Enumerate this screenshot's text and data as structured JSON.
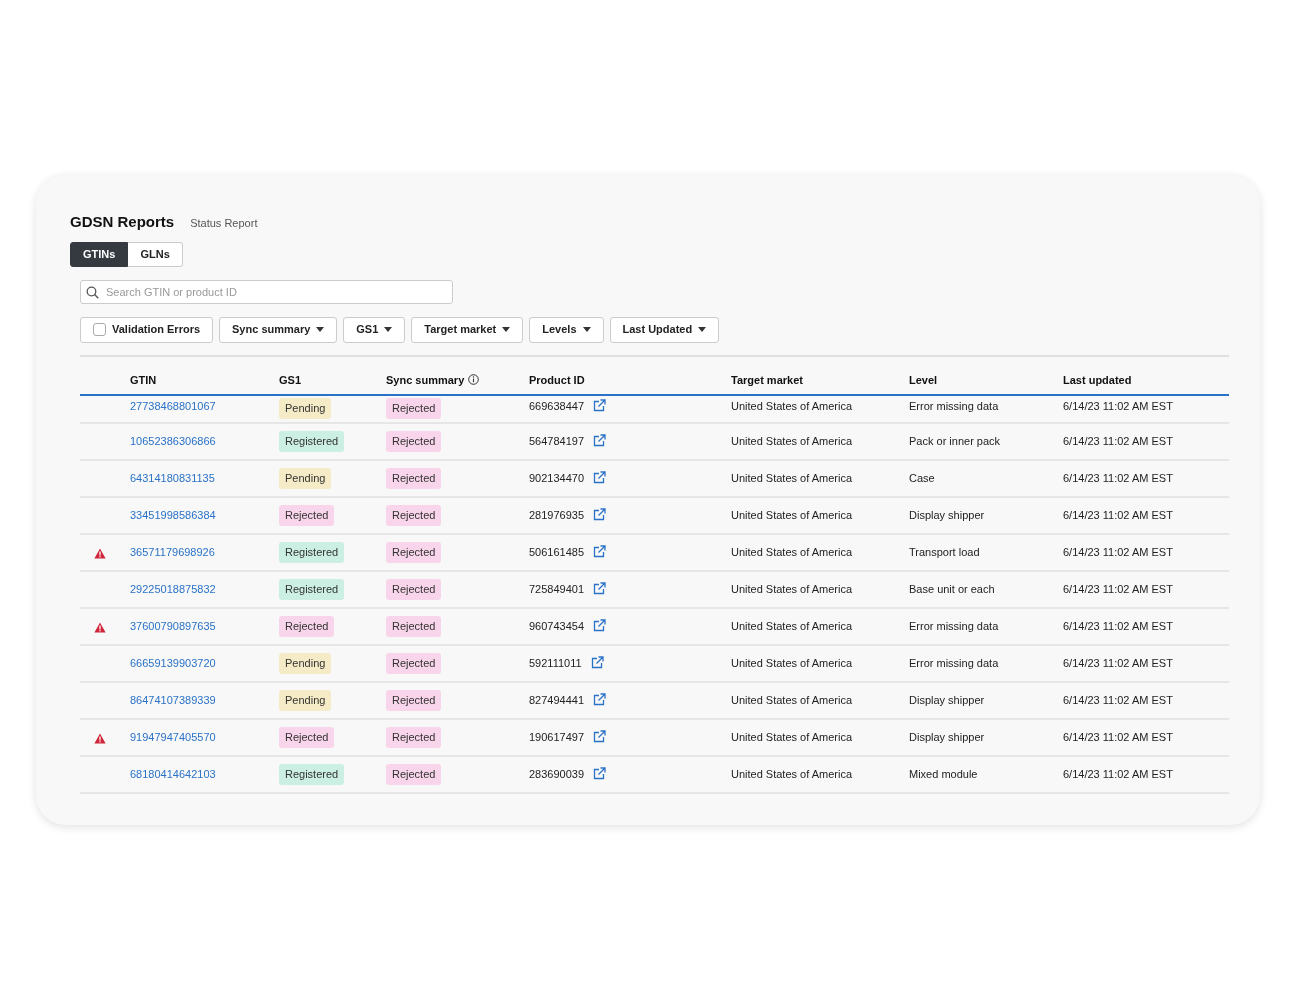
{
  "header": {
    "title": "GDSN Reports",
    "subtitle": "Status Report"
  },
  "tabs": [
    {
      "label": "GTINs",
      "selected": true
    },
    {
      "label": "GLNs",
      "selected": false
    }
  ],
  "search": {
    "placeholder": "Search GTIN or product ID"
  },
  "filters": [
    {
      "kind": "checkbox",
      "label": "Validation Errors",
      "checked": false
    },
    {
      "kind": "dropdown",
      "label": "Sync summary"
    },
    {
      "kind": "dropdown",
      "label": "GS1"
    },
    {
      "kind": "dropdown",
      "label": "Target market"
    },
    {
      "kind": "dropdown",
      "label": "Levels"
    },
    {
      "kind": "dropdown",
      "label": "Last Updated"
    }
  ],
  "table": {
    "columns": [
      {
        "label": "GTIN"
      },
      {
        "label": "GS1"
      },
      {
        "label": "Sync summary",
        "info": true
      },
      {
        "label": "Product ID"
      },
      {
        "label": "Target market"
      },
      {
        "label": "Level"
      },
      {
        "label": "Last updated"
      }
    ],
    "rows": [
      {
        "warning": false,
        "gtin": "27738468801067",
        "gs1": {
          "label": "Pending",
          "kind": "pending"
        },
        "sync": {
          "label": "Rejected",
          "kind": "rejected"
        },
        "product_id": "669638447",
        "target_market": "United States of America",
        "level": "Error missing data",
        "last_updated": "6/14/23 11:02 AM EST"
      },
      {
        "warning": false,
        "gtin": "10652386306866",
        "gs1": {
          "label": "Registered",
          "kind": "registered"
        },
        "sync": {
          "label": "Rejected",
          "kind": "rejected"
        },
        "product_id": "564784197",
        "target_market": "United States of America",
        "level": "Pack or inner pack",
        "last_updated": "6/14/23 11:02 AM EST"
      },
      {
        "warning": false,
        "gtin": "64314180831135",
        "gs1": {
          "label": "Pending",
          "kind": "pending"
        },
        "sync": {
          "label": "Rejected",
          "kind": "rejected"
        },
        "product_id": "902134470",
        "target_market": "United States of America",
        "level": "Case",
        "last_updated": "6/14/23 11:02 AM EST"
      },
      {
        "warning": false,
        "gtin": "33451998586384",
        "gs1": {
          "label": "Rejected",
          "kind": "rejected"
        },
        "sync": {
          "label": "Rejected",
          "kind": "rejected"
        },
        "product_id": "281976935",
        "target_market": "United States of America",
        "level": "Display shipper",
        "last_updated": "6/14/23 11:02 AM EST"
      },
      {
        "warning": true,
        "gtin": "36571179698926",
        "gs1": {
          "label": "Registered",
          "kind": "registered"
        },
        "sync": {
          "label": "Rejected",
          "kind": "rejected"
        },
        "product_id": "506161485",
        "target_market": "United States of America",
        "level": "Transport load",
        "last_updated": "6/14/23 11:02 AM EST"
      },
      {
        "warning": false,
        "gtin": "29225018875832",
        "gs1": {
          "label": "Registered",
          "kind": "registered"
        },
        "sync": {
          "label": "Rejected",
          "kind": "rejected"
        },
        "product_id": "725849401",
        "target_market": "United States of America",
        "level": "Base unit or each",
        "last_updated": "6/14/23 11:02 AM EST"
      },
      {
        "warning": true,
        "gtin": "37600790897635",
        "gs1": {
          "label": "Rejected",
          "kind": "rejected"
        },
        "sync": {
          "label": "Rejected",
          "kind": "rejected"
        },
        "product_id": "960743454",
        "target_market": "United States of America",
        "level": "Error missing data",
        "last_updated": "6/14/23 11:02 AM EST"
      },
      {
        "warning": false,
        "gtin": "66659139903720",
        "gs1": {
          "label": "Pending",
          "kind": "pending"
        },
        "sync": {
          "label": "Rejected",
          "kind": "rejected"
        },
        "product_id": "592111011",
        "target_market": "United States of America",
        "level": "Error missing data",
        "last_updated": "6/14/23 11:02 AM EST"
      },
      {
        "warning": false,
        "gtin": "86474107389339",
        "gs1": {
          "label": "Pending",
          "kind": "pending"
        },
        "sync": {
          "label": "Rejected",
          "kind": "rejected"
        },
        "product_id": "827494441",
        "target_market": "United States of America",
        "level": "Display shipper",
        "last_updated": "6/14/23 11:02 AM EST"
      },
      {
        "warning": true,
        "gtin": "91947947405570",
        "gs1": {
          "label": "Rejected",
          "kind": "rejected"
        },
        "sync": {
          "label": "Rejected",
          "kind": "rejected"
        },
        "product_id": "190617497",
        "target_market": "United States of America",
        "level": "Display shipper",
        "last_updated": "6/14/23 11:02 AM EST"
      },
      {
        "warning": false,
        "gtin": "68180414642103",
        "gs1": {
          "label": "Registered",
          "kind": "registered"
        },
        "sync": {
          "label": "Rejected",
          "kind": "rejected"
        },
        "product_id": "283690039",
        "target_market": "United States of America",
        "level": "Mixed module",
        "last_updated": "6/14/23 11:02 AM EST"
      }
    ]
  }
}
